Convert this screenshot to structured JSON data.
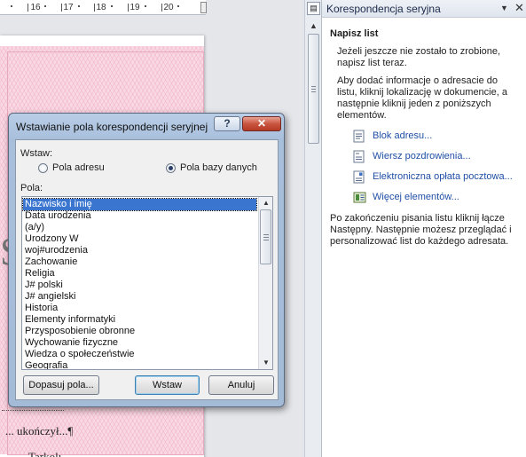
{
  "document": {
    "ruler_ticks": [
      "16",
      "17",
      "18",
      "19",
      "20"
    ],
    "big_letter": "S",
    "text_line_1": "... ukończył...¶",
    "text_line_2": "Tarkolı"
  },
  "task_pane": {
    "title": "Korespondencja seryjna",
    "heading": "Napisz list",
    "para1": "Jeżeli jeszcze nie zostało to zrobione, napisz list teraz.",
    "para2": "Aby dodać informacje o adresacie do listu, kliknij lokalizację w dokumencie, a następnie kliknij jeden z poniższych elementów.",
    "links": [
      {
        "label": "Blok adresu...",
        "icon": "address-block-icon"
      },
      {
        "label": "Wiersz pozdrowienia...",
        "icon": "greeting-line-icon"
      },
      {
        "label": "Elektroniczna opłata pocztowa...",
        "icon": "electronic-postage-icon"
      },
      {
        "label": "Więcej elementów...",
        "icon": "more-items-icon"
      }
    ],
    "para3": "Po zakończeniu pisania listu kliknij łącze Następny. Następnie możesz przeglądać i personalizować list do każdego adresata."
  },
  "dialog": {
    "title": "Wstawianie pola korespondencji seryjnej",
    "help_label": "?",
    "close_label": "✕",
    "insert_label": "Wstaw:",
    "radio_address": "Pola adresu",
    "radio_database": "Pola bazy danych",
    "selected_radio": "database",
    "fields_label": "Pola:",
    "fields": [
      "Nazwisko i imię",
      "Data urodzenia",
      "(a/y)",
      "Urodzony W",
      "woj#urodzenia",
      "Zachowanie",
      "Religia",
      "J# polski",
      "J# angielski",
      "Historia",
      "Elementy informatyki",
      "Przysposobienie obronne",
      "Wychowanie fizyczne",
      "Wiedza o społeczeństwie",
      "Geografia"
    ],
    "selected_field": "Nazwisko i imię",
    "btn_match": "Dopasuj pola...",
    "btn_insert": "Wstaw",
    "btn_cancel": "Anuluj"
  }
}
